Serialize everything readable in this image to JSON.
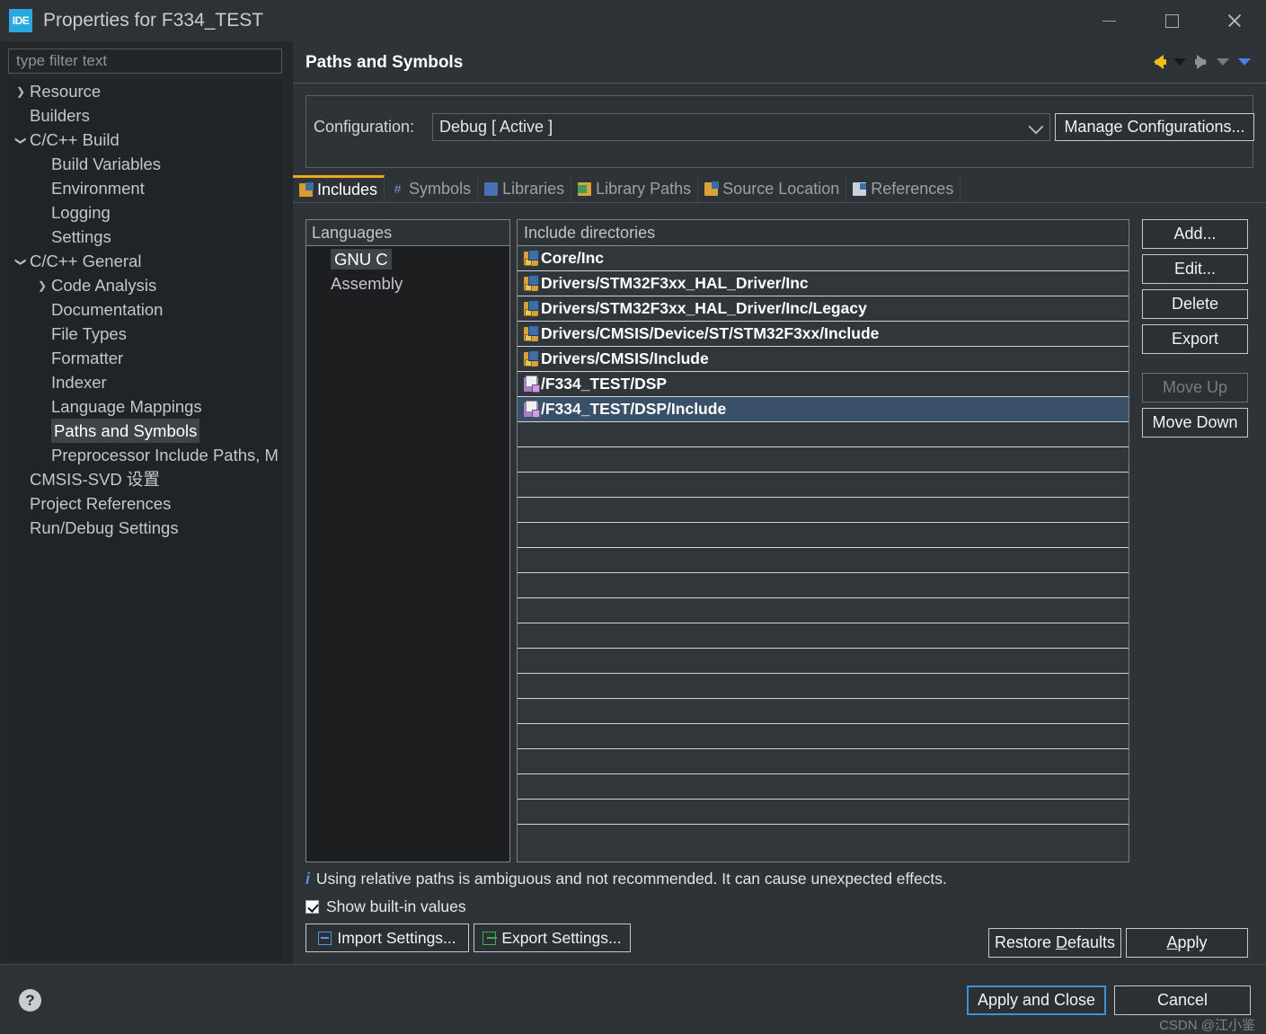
{
  "window": {
    "icon_label": "IDE",
    "title": "Properties for F334_TEST",
    "minimize": "minimize-icon",
    "maximize": "maximize-icon",
    "close": "close-icon"
  },
  "sidebar": {
    "filter_placeholder": "type filter text",
    "items": [
      {
        "label": "Resource",
        "indent": 0,
        "twisty": "right",
        "selected": false
      },
      {
        "label": "Builders",
        "indent": 0,
        "twisty": "none",
        "selected": false
      },
      {
        "label": "C/C++ Build",
        "indent": 0,
        "twisty": "down",
        "selected": false
      },
      {
        "label": "Build Variables",
        "indent": 1,
        "twisty": "none",
        "selected": false
      },
      {
        "label": "Environment",
        "indent": 1,
        "twisty": "none",
        "selected": false
      },
      {
        "label": "Logging",
        "indent": 1,
        "twisty": "none",
        "selected": false
      },
      {
        "label": "Settings",
        "indent": 1,
        "twisty": "none",
        "selected": false
      },
      {
        "label": "C/C++ General",
        "indent": 0,
        "twisty": "down",
        "selected": false
      },
      {
        "label": "Code Analysis",
        "indent": 1,
        "twisty": "right",
        "selected": false
      },
      {
        "label": "Documentation",
        "indent": 1,
        "twisty": "none",
        "selected": false
      },
      {
        "label": "File Types",
        "indent": 1,
        "twisty": "none",
        "selected": false
      },
      {
        "label": "Formatter",
        "indent": 1,
        "twisty": "none",
        "selected": false
      },
      {
        "label": "Indexer",
        "indent": 1,
        "twisty": "none",
        "selected": false
      },
      {
        "label": "Language Mappings",
        "indent": 1,
        "twisty": "none",
        "selected": false
      },
      {
        "label": "Paths and Symbols",
        "indent": 1,
        "twisty": "none",
        "selected": true
      },
      {
        "label": "Preprocessor Include Paths, M",
        "indent": 1,
        "twisty": "none",
        "selected": false
      },
      {
        "label": "CMSIS-SVD 设置",
        "indent": 0,
        "twisty": "none",
        "selected": false
      },
      {
        "label": "Project References",
        "indent": 0,
        "twisty": "none",
        "selected": false
      },
      {
        "label": "Run/Debug Settings",
        "indent": 0,
        "twisty": "none",
        "selected": false
      }
    ]
  },
  "page": {
    "title": "Paths and Symbols",
    "nav": {
      "back": "back-arrow-icon",
      "back_menu": "back-dropdown-icon",
      "forward": "forward-arrow-icon",
      "forward_menu": "forward-dropdown-icon",
      "view_menu": "view-menu-icon"
    }
  },
  "configuration": {
    "label": "Configuration:",
    "value": "Debug  [ Active ]",
    "manage_label": "Manage Configurations..."
  },
  "tabs": [
    {
      "label": "Includes",
      "icon": "includes-icon",
      "active": true
    },
    {
      "label": "Symbols",
      "icon": "symbols-icon",
      "active": false
    },
    {
      "label": "Libraries",
      "icon": "libraries-icon",
      "active": false
    },
    {
      "label": "Library Paths",
      "icon": "library-paths-icon",
      "active": false
    },
    {
      "label": "Source Location",
      "icon": "source-location-icon",
      "active": false
    },
    {
      "label": "References",
      "icon": "references-icon",
      "active": false
    }
  ],
  "languages": {
    "header": "Languages",
    "items": [
      {
        "label": "GNU C",
        "selected": true
      },
      {
        "label": "Assembly",
        "selected": false
      }
    ]
  },
  "include_directories": {
    "header": "Include directories",
    "rows": [
      {
        "path": "Core/Inc",
        "icon": "folder-include-icon",
        "selected": false
      },
      {
        "path": "Drivers/STM32F3xx_HAL_Driver/Inc",
        "icon": "folder-include-icon",
        "selected": false
      },
      {
        "path": "Drivers/STM32F3xx_HAL_Driver/Inc/Legacy",
        "icon": "folder-include-icon",
        "selected": false
      },
      {
        "path": "Drivers/CMSIS/Device/ST/STM32F3xx/Include",
        "icon": "folder-include-icon",
        "selected": false
      },
      {
        "path": "Drivers/CMSIS/Include",
        "icon": "folder-include-icon",
        "selected": false
      },
      {
        "path": "/F334_TEST/DSP",
        "icon": "workspace-folder-icon",
        "selected": false
      },
      {
        "path": "/F334_TEST/DSP/Include",
        "icon": "workspace-folder-icon",
        "selected": true
      }
    ],
    "empty_row_count": 16
  },
  "side_buttons": [
    {
      "label": "Add...",
      "enabled": true
    },
    {
      "label": "Edit...",
      "enabled": true
    },
    {
      "label": "Delete",
      "enabled": true
    },
    {
      "label": "Export",
      "enabled": true
    },
    {
      "label": "Move Up",
      "enabled": false
    },
    {
      "label": "Move Down",
      "enabled": true
    }
  ],
  "note": {
    "icon": "info-icon",
    "text": "Using relative paths is ambiguous and not recommended. It can cause unexpected effects."
  },
  "show_builtin": {
    "label": "Show built-in values",
    "checked": true
  },
  "settings_buttons": {
    "import_label": "Import Settings...",
    "export_label": "Export Settings..."
  },
  "footer_buttons": {
    "restore_pre": "Restore ",
    "restore_key": "D",
    "restore_post": "efaults",
    "apply_key": "A",
    "apply_post": "pply",
    "apply_and_close": "Apply and Close",
    "cancel": "Cancel"
  },
  "bottom": {
    "help_glyph": "?",
    "watermark": "CSDN @江小鉴"
  },
  "colors": {
    "accent_tab": "#f0a91e",
    "selection": "#3a5068",
    "primary_button_border": "#3d8fd6",
    "back_arrow": "#f2bf14"
  }
}
